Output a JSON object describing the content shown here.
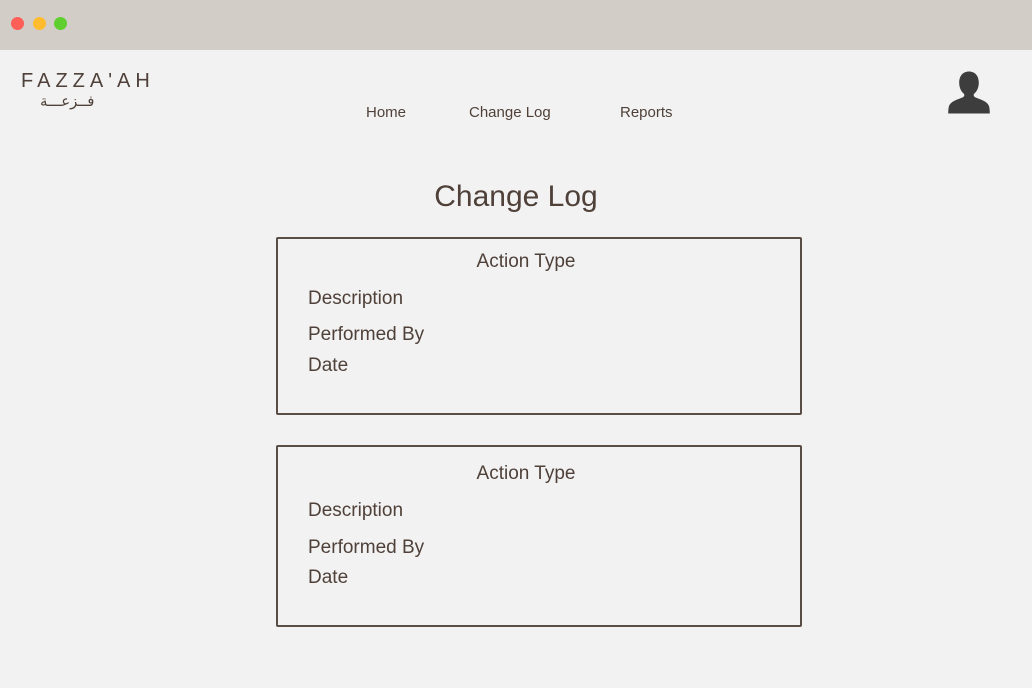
{
  "brand": {
    "name_latin": "FAZZA'AH",
    "name_arabic": "فــزعـــة"
  },
  "nav": {
    "items": [
      {
        "label": "Home"
      },
      {
        "label": "Change Log"
      },
      {
        "label": "Reports"
      }
    ]
  },
  "user": {
    "icon": "user-avatar-icon"
  },
  "page": {
    "title": "Change Log"
  },
  "log_entries": [
    {
      "action_type": "Action Type",
      "description": "Description",
      "performed_by": "Performed By",
      "date": "Date"
    },
    {
      "action_type": "Action Type",
      "description": "Description",
      "performed_by": "Performed By",
      "date": "Date"
    }
  ],
  "colors": {
    "background": "#f2f2f2",
    "titlebar": "#d3cdc8",
    "text": "#4f4139",
    "border": "#5a4d45",
    "avatar": "#3d3d3d",
    "window_close": "#ff5f57",
    "window_minimize": "#febc2e",
    "window_maximize": "#5fcf2f"
  }
}
